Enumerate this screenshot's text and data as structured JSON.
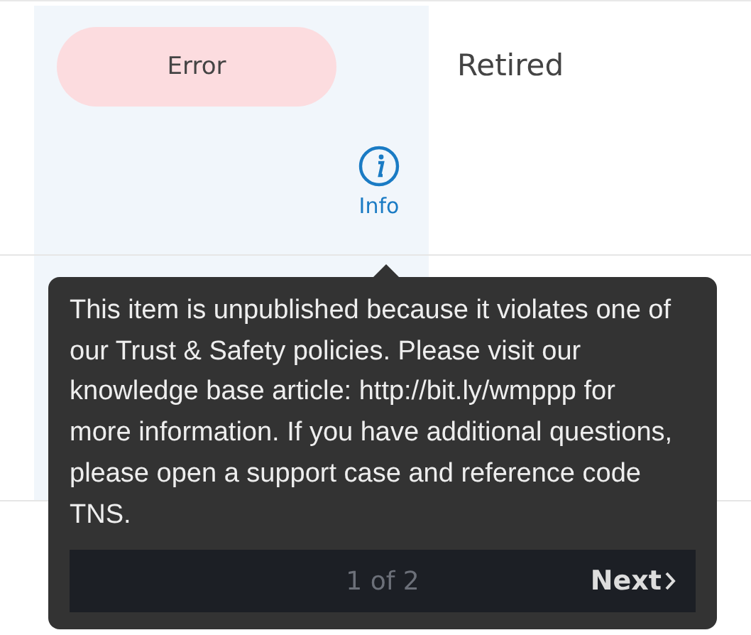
{
  "table": {
    "rows": [
      {
        "status": "Error",
        "info_label": "Info",
        "lifecycle": "Retired"
      },
      {}
    ]
  },
  "tooltip": {
    "text": "This item is unpublished because it violates one of our Trust & Safety policies. Please visit our knowledge base article: http://bit.ly/wmppp for more information. If you have additional questions, please open a support case and reference code TNS.",
    "pager": "1 of 2",
    "next": "Next"
  }
}
